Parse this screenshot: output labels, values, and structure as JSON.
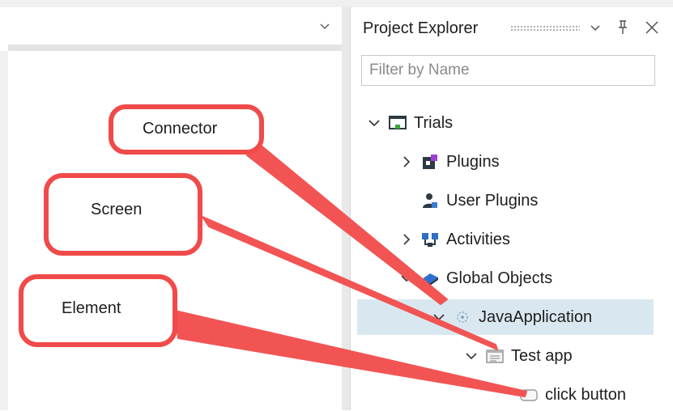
{
  "panel": {
    "title": "Project Explorer",
    "filter_placeholder": "Filter by Name"
  },
  "tree": [
    {
      "label": "Trials",
      "icon": "project-icon",
      "expander": "expanded"
    },
    {
      "label": "Plugins",
      "icon": "plugins-icon",
      "expander": "collapsed"
    },
    {
      "label": "User Plugins",
      "icon": "user-plugins-icon",
      "expander": "none"
    },
    {
      "label": "Activities",
      "icon": "activities-icon",
      "expander": "collapsed"
    },
    {
      "label": "Global Objects",
      "icon": "global-objects-icon",
      "expander": "expanded"
    },
    {
      "label": "JavaApplication",
      "icon": "connector-icon",
      "expander": "expanded",
      "selected": true
    },
    {
      "label": "Test app",
      "icon": "screen-icon",
      "expander": "expanded"
    },
    {
      "label": "click button",
      "icon": "element-icon",
      "expander": "none"
    }
  ],
  "callouts": {
    "connector": "Connector",
    "screen": "Screen",
    "element": "Element"
  },
  "colors": {
    "callout_border": "#f04a4a",
    "selection": "#d9e8f0"
  }
}
